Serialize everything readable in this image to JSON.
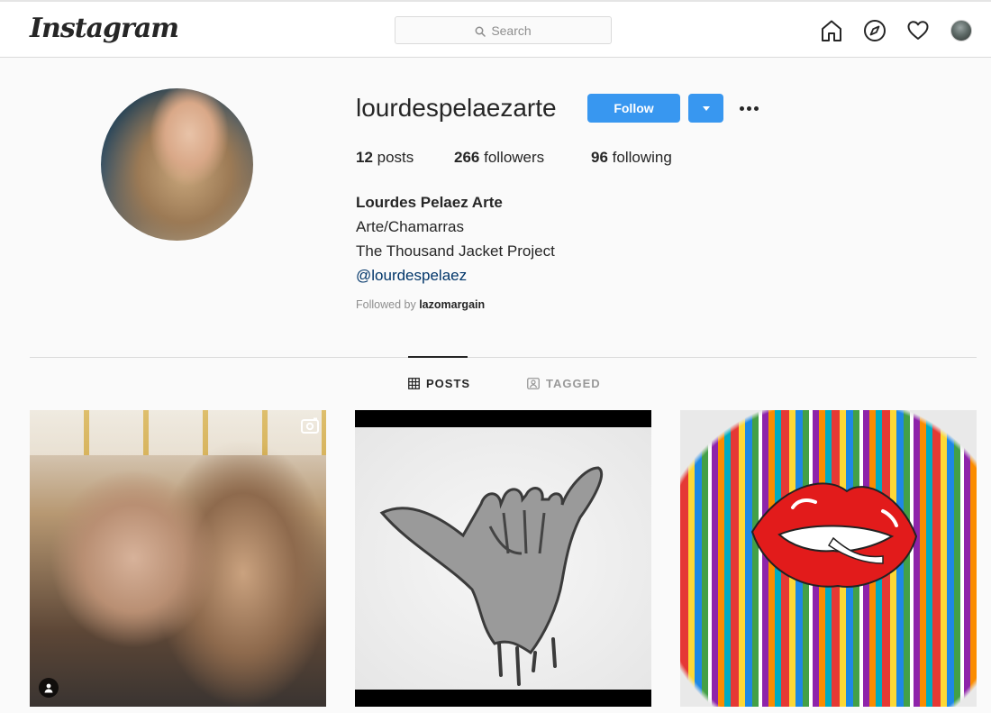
{
  "nav": {
    "logo": "Instagram",
    "search_placeholder": "Search"
  },
  "profile": {
    "username": "lourdespelaezarte",
    "follow_label": "Follow",
    "stats": {
      "posts_count": "12",
      "posts_label": " posts",
      "followers_count": "266",
      "followers_label": " followers",
      "following_count": "96",
      "following_label": " following"
    },
    "bio": {
      "full_name": "Lourdes Pelaez Arte",
      "line1": "Arte/Chamarras",
      "line2": "The Thousand Jacket Project",
      "link": "@lourdespelaez"
    },
    "followed_by_label": "Followed by ",
    "followed_by_user": "lazomargain"
  },
  "tabs": {
    "posts_label": "POSTS",
    "tagged_label": "TAGGED"
  },
  "colors": {
    "accent": "#3897f0",
    "link": "#003569",
    "muted": "#8e8e8e"
  },
  "icons": [
    "home-icon",
    "explore-icon",
    "heart-icon",
    "search-icon",
    "grid-icon",
    "tagged-icon",
    "video-icon",
    "user-tag-icon",
    "more-icon"
  ]
}
